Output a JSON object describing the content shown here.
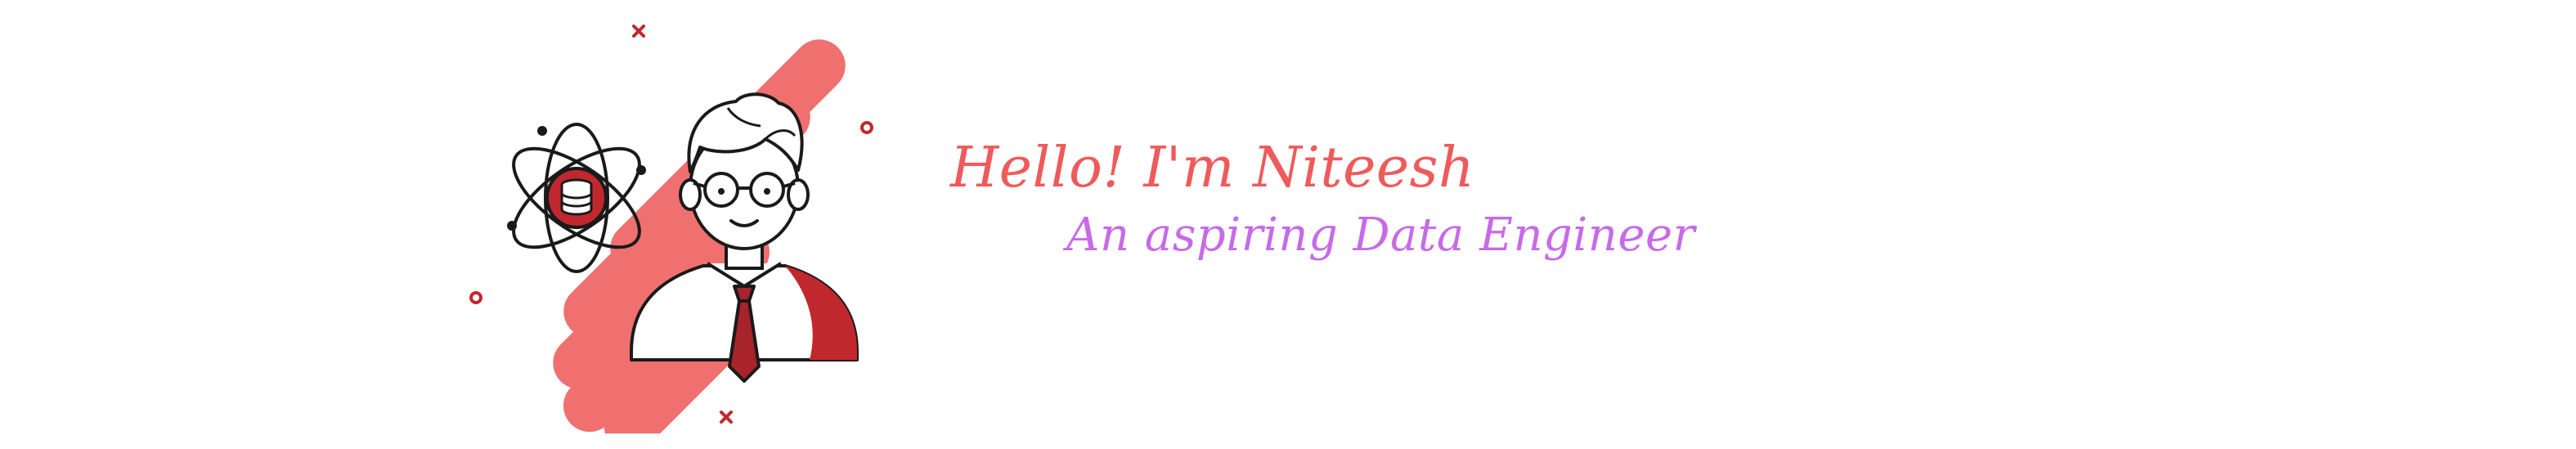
{
  "banner": {
    "greeting": "Hello! I'm Niteesh",
    "subtitle": "An aspiring Data Engineer",
    "colors": {
      "greeting": "#ef5a5a",
      "subtitle": "#c76ae8",
      "blob": "#f07070",
      "accent": "#c0282d",
      "line": "#1a1a1a"
    },
    "illustration": {
      "character": "developer-avatar",
      "icon": "database-atom-icon",
      "decorations": [
        "cross-icon",
        "circle-icon"
      ]
    }
  }
}
